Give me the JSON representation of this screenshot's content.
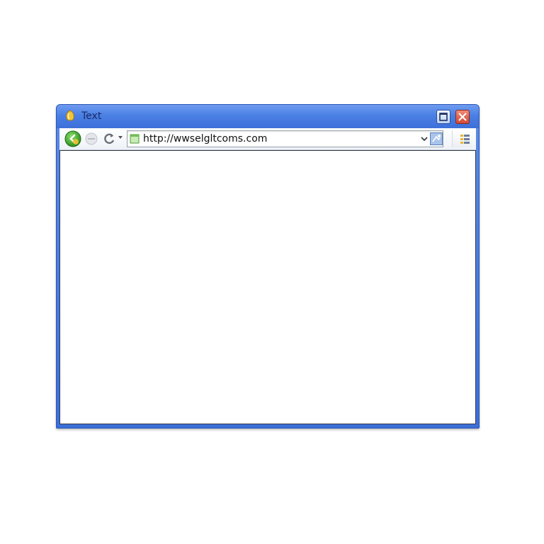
{
  "window": {
    "title": "Text"
  },
  "toolbar": {
    "back_icon": "back-arrow-icon",
    "forward_icon": "forward-arrow-icon",
    "refresh_icon": "refresh-icon"
  },
  "address_bar": {
    "url": "http://wwselgltcoms.com",
    "page_icon": "page-icon",
    "go_icon": "go-icon"
  },
  "colors": {
    "titlebar": "#4a7fe4",
    "frame": "#3c6fd8",
    "close": "#d24a35",
    "content": "#ffffff"
  }
}
